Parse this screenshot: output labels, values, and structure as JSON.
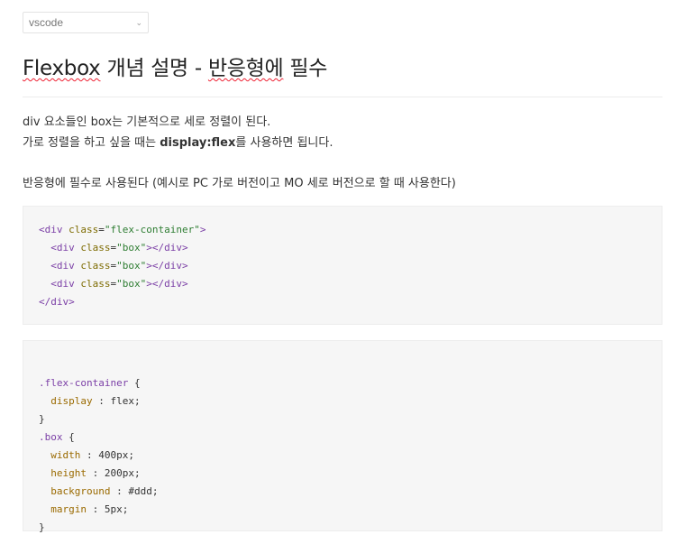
{
  "language_select": {
    "value": "vscode"
  },
  "title": {
    "word1": "Flexbox",
    "mid": " 개념 설명 - ",
    "word2": "반응형에",
    "end": " 필수"
  },
  "para": {
    "line1": "div 요소들인 box는 기본적으로 세로 정렬이 된다.",
    "line2_a": "가로 정렬을 하고 싶을 때는 ",
    "line2_bold": "display:flex",
    "line2_b": "를 사용하면 됩니다.",
    "line3": "반응형에 필수로 사용된다 (예시로 PC 가로 버전이고 MO 세로 버전으로 할 때 사용한다)"
  },
  "html_code": {
    "container_open_tag": "<div",
    "class_attr": "class",
    "container_class": "\"flex-container\"",
    "gt": ">",
    "box_class": "\"box\"",
    "div_close": "></div>",
    "close": "</div>"
  },
  "css_code": {
    "selector1": ".flex-container",
    "open": " {",
    "display_prop": "display",
    "display_val": "flex;",
    "close": "}",
    "selector2": ".box",
    "width_prop": "width",
    "width_val": "400px;",
    "height_prop": "height",
    "height_val": "200px;",
    "bg_prop": "background",
    "bg_val": "#ddd;",
    "margin_prop": "margin",
    "margin_val": "5px;",
    "sep": " : "
  }
}
